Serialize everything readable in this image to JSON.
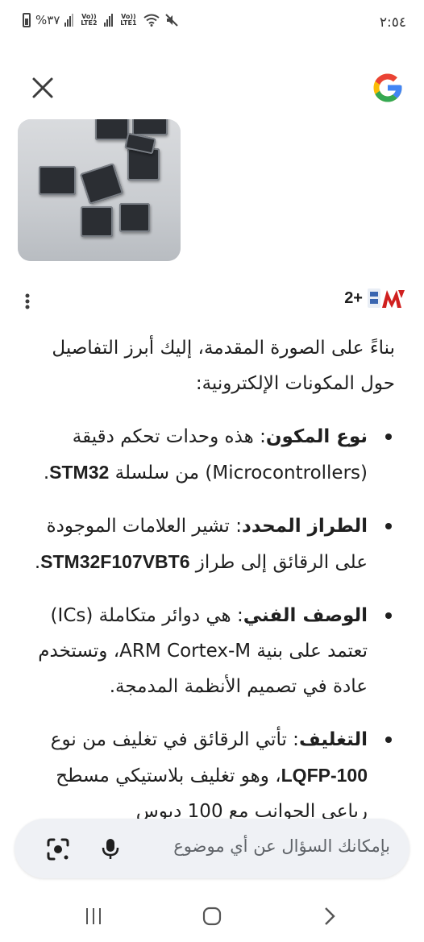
{
  "status_bar": {
    "time": "٢:٥٤",
    "battery": "%٣٧",
    "sim2_label": "Vo)) LTE2",
    "sim1_label": "Vo)) LTE1"
  },
  "source": {
    "badge": "2+"
  },
  "answer": {
    "intro": "بناءً على الصورة المقدمة، إليك أبرز التفاصيل حول المكونات الإلكترونية:",
    "items": [
      {
        "label": "نوع المكون",
        "text_a": ": هذه وحدات تحكم دقيقة (Microcontrollers) من سلسلة ",
        "bold": "STM32",
        "text_b": "."
      },
      {
        "label": "الطراز المحدد",
        "text_a": ": تشير العلامات الموجودة على الرقائق إلى طراز ",
        "bold": "STM32F107VBT6",
        "text_b": "."
      },
      {
        "label": "الوصف الفني",
        "text_a": ": هي دوائر متكاملة (ICs) تعتمد على بنية ARM Cortex-M، وتستخدم عادة في تصميم الأنظمة المدمجة.",
        "bold": "",
        "text_b": ""
      },
      {
        "label": "التغليف",
        "text_a": ": تأتي الرقائق في تغليف من نوع ",
        "bold": "LQFP-100",
        "text_b": "، وهو تغليف بلاستيكي مسطح رباعي الجوانب مع 100 دبوس"
      }
    ]
  },
  "search": {
    "placeholder": "بإمكانك السؤال عن أي موضوع"
  },
  "icons": {
    "close": "close-icon",
    "google": "google-logo",
    "more": "more-vert-icon",
    "mic": "mic-icon",
    "lens": "lens-icon",
    "recents": "recents-icon",
    "home": "home-icon",
    "back": "back-icon"
  },
  "colors": {
    "google_blue": "#4285F4",
    "google_red": "#EA4335",
    "google_yellow": "#FBBC05",
    "google_green": "#34A853",
    "search_bg": "#eff1f5",
    "brand_red": "#d0201f"
  }
}
